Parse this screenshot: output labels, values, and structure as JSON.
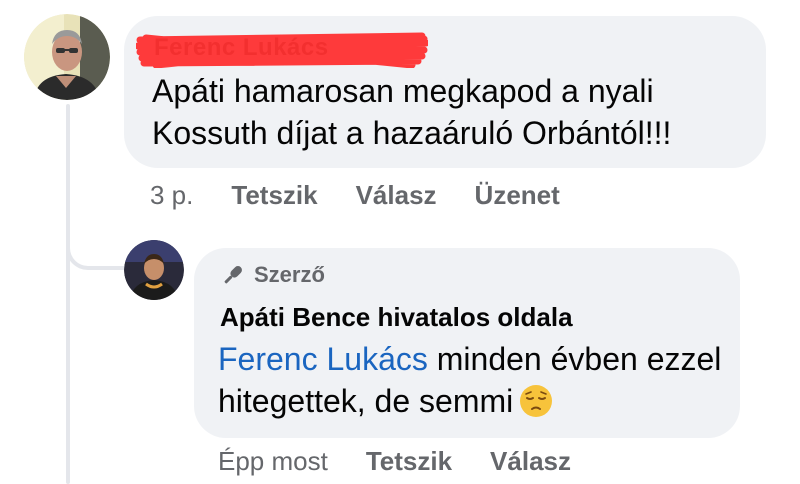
{
  "comment": {
    "author_name": "Ferenc Lukács",
    "text": "Apáti hamarosan megkapod a nyali Kossuth díjat a hazaáruló Orbántól!!!",
    "time": "3 p.",
    "actions": [
      "Tetszik",
      "Válasz",
      "Üzenet"
    ]
  },
  "reply": {
    "badge": "Szerző",
    "badge_icon": "microphone-icon",
    "page_name": "Apáti Bence hivatalos oldala",
    "mention": "Ferenc Lukács",
    "text": " minden évben ezzel hitegettek, de semmi",
    "emoji": "pensive-face-icon",
    "time": "Épp most",
    "actions": [
      "Tetszik",
      "Válasz"
    ]
  },
  "colors": {
    "bubble": "#f0f2f5",
    "secondary_text": "#65676b",
    "mention": "#1a65c0",
    "redaction": "#ff2a2a"
  }
}
